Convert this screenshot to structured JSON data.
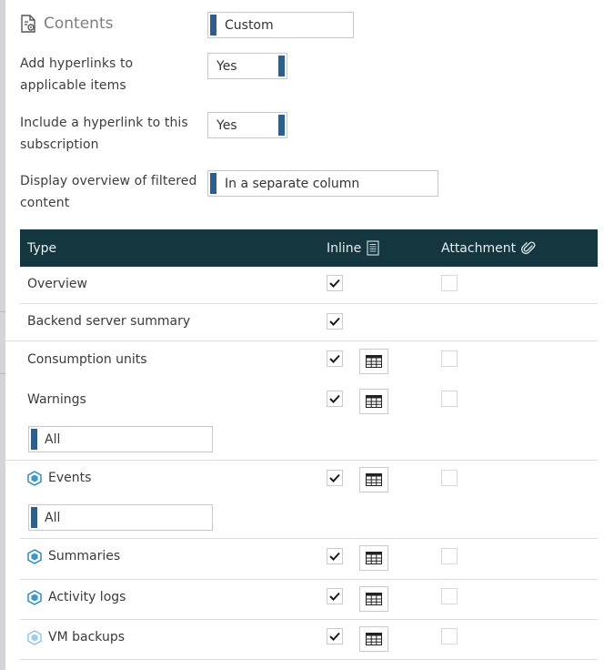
{
  "settings": {
    "contents_label": "Contents",
    "contents_value": "Custom",
    "hyperlinks_label_line1": "Add hyperlinks to",
    "hyperlinks_label_line2": "applicable items",
    "hyperlinks_value": "Yes",
    "subscription_link_label_line1": "Include a hyperlink to this",
    "subscription_link_label_line2": "subscription",
    "subscription_link_value": "Yes",
    "overview_label_line1": "Display overview of filtered",
    "overview_label_line2": "content",
    "overview_value": "In a separate column"
  },
  "table": {
    "header": {
      "type": "Type",
      "inline": "Inline",
      "attachment": "Attachment"
    },
    "rows": [
      {
        "label": "Overview",
        "icon": "",
        "inline_checked": true,
        "has_grid": false,
        "has_attachment": true,
        "filter": ""
      },
      {
        "label": "Backend server summary",
        "icon": "",
        "inline_checked": true,
        "has_grid": false,
        "has_attachment": false,
        "filter": ""
      },
      {
        "label": "Consumption units",
        "icon": "",
        "inline_checked": true,
        "has_grid": true,
        "has_attachment": true,
        "filter": ""
      },
      {
        "label": "Warnings",
        "icon": "",
        "inline_checked": true,
        "has_grid": true,
        "has_attachment": true,
        "filter": "All"
      },
      {
        "label": "Events",
        "icon": "hexagon-icon",
        "inline_checked": true,
        "has_grid": true,
        "has_attachment": true,
        "filter": "All"
      },
      {
        "label": "Summaries",
        "icon": "hexagon-icon",
        "inline_checked": true,
        "has_grid": true,
        "has_attachment": true,
        "filter": ""
      },
      {
        "label": "Activity logs",
        "icon": "hexagon-icon",
        "inline_checked": true,
        "has_grid": true,
        "has_attachment": true,
        "filter": ""
      },
      {
        "label": "VM backups",
        "icon": "hexagon-light-icon",
        "inline_checked": true,
        "has_grid": true,
        "has_attachment": true,
        "filter": ""
      }
    ]
  },
  "colors": {
    "header_bg": "#14363e",
    "accent_bar": "#2e5f8a",
    "hex_icon": "#1d86c2"
  }
}
